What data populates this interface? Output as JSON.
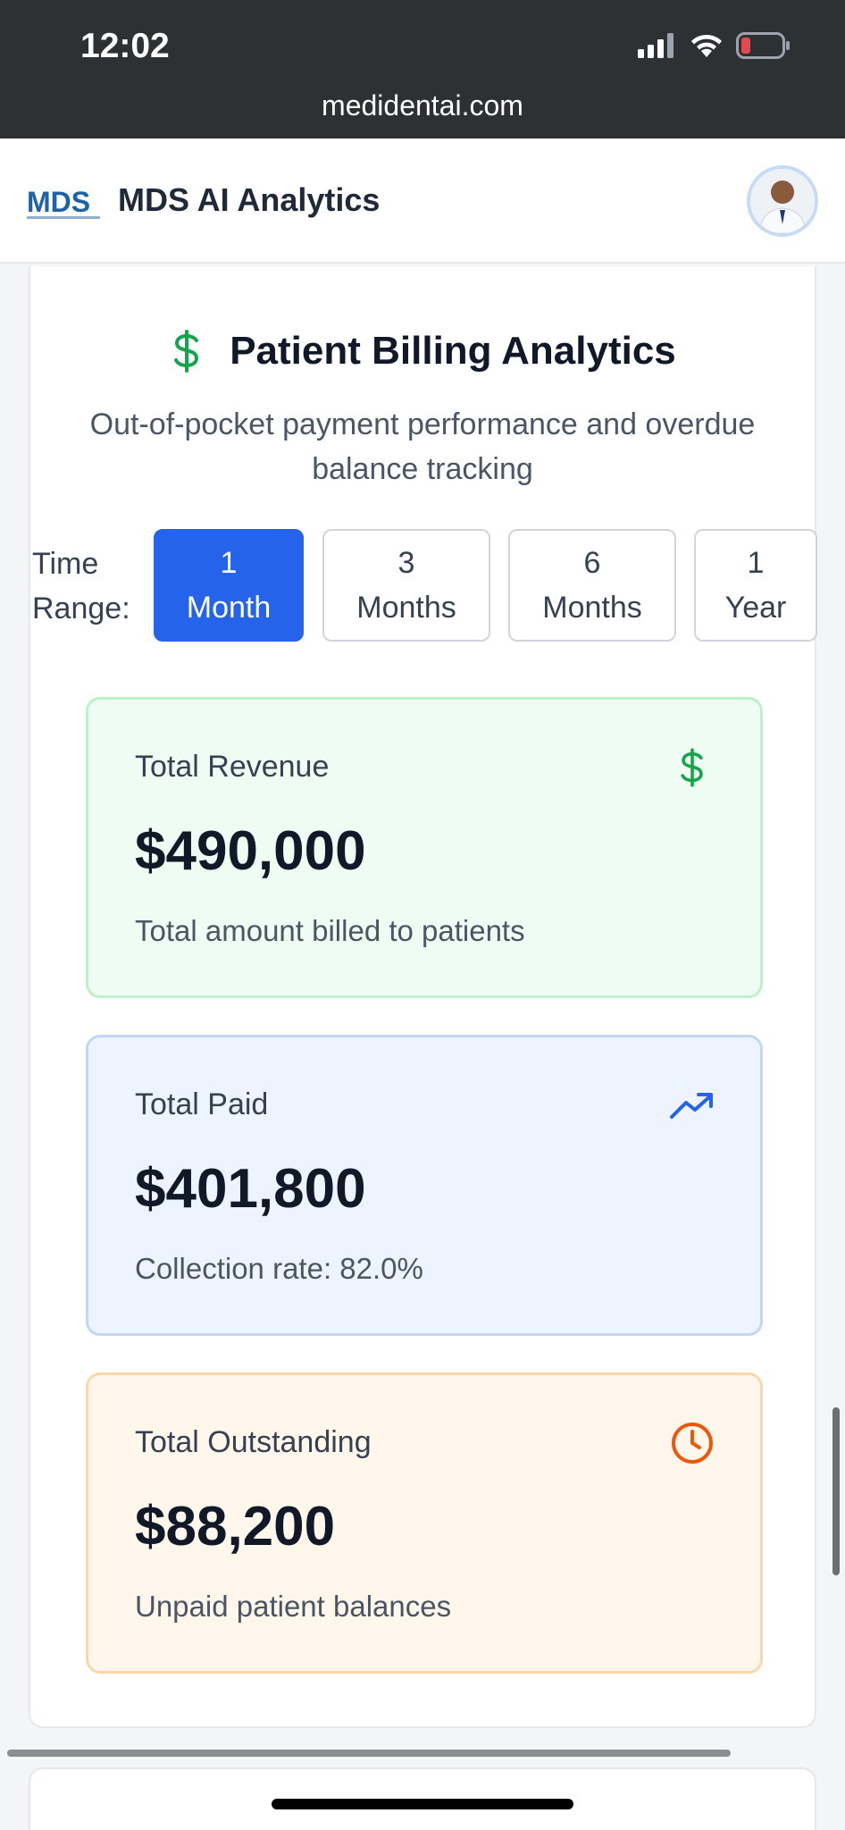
{
  "status_bar": {
    "time": "12:02",
    "url": "medidentai.com"
  },
  "app": {
    "title": "MDS AI Analytics",
    "logo_icon": "mds-logo-icon",
    "avatar_icon": "user-avatar-icon"
  },
  "section": {
    "title": "Patient Billing Analytics",
    "subtitle": "Out-of-pocket payment performance and overdue balance tracking",
    "icon": "dollar-icon"
  },
  "time_range": {
    "label": "Time Range:",
    "options": [
      "1 Month",
      "3 Months",
      "6 Months",
      "1 Year"
    ],
    "selected": "1 Month"
  },
  "stats": [
    {
      "label": "Total Revenue",
      "value": "$490,000",
      "description": "Total amount billed to patients",
      "icon": "dollar-icon",
      "color": "#16a34a"
    },
    {
      "label": "Total Paid",
      "value": "$401,800",
      "description": "Collection rate: 82.0%",
      "icon": "trending-up-icon",
      "color": "#2563eb"
    },
    {
      "label": "Total Outstanding",
      "value": "$88,200",
      "description": "Unpaid patient balances",
      "icon": "clock-icon",
      "color": "#ea580c"
    }
  ],
  "colors": {
    "accent": "#2563eb",
    "green": "#16a34a",
    "orange": "#ea580c"
  }
}
